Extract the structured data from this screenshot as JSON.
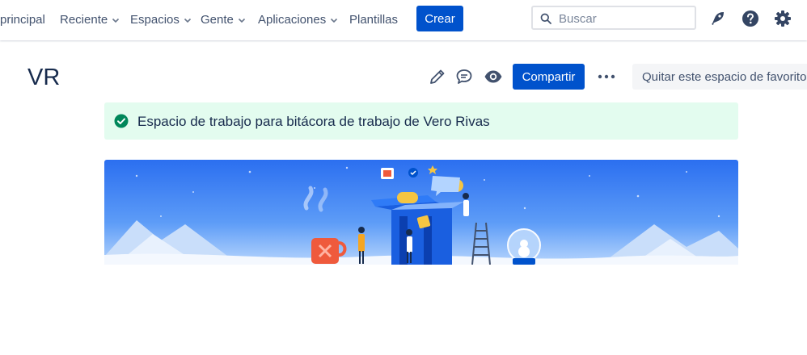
{
  "nav": {
    "items": [
      {
        "label": "principal",
        "dropdown": false
      },
      {
        "label": "Reciente",
        "dropdown": true
      },
      {
        "label": "Espacios",
        "dropdown": true
      },
      {
        "label": "Gente",
        "dropdown": true
      },
      {
        "label": "Aplicaciones",
        "dropdown": true
      },
      {
        "label": "Plantillas",
        "dropdown": false
      }
    ],
    "create_label": "Crear",
    "search_placeholder": "Buscar",
    "icons": [
      "notifications-rocket-icon",
      "help-icon",
      "settings-gear-icon"
    ]
  },
  "space": {
    "title": "VR",
    "actions": {
      "edit_icon": "pencil-icon",
      "comment_icon": "comment-icon",
      "watch_icon": "eye-icon",
      "share_label": "Compartir",
      "more_icon": "more-icon",
      "unfavorite_label": "Quitar este espacio de favoritos"
    },
    "info_message": "Espacio de trabajo para bitácora de trabajo de Vero Rivas",
    "info_icon": "check-circle-icon",
    "banner": "illustration"
  },
  "colors": {
    "primary": "#0052cc",
    "success": "#00875a",
    "success_bg": "#e3fcef",
    "text": "#172b4d",
    "subtle_text": "#42526e"
  }
}
